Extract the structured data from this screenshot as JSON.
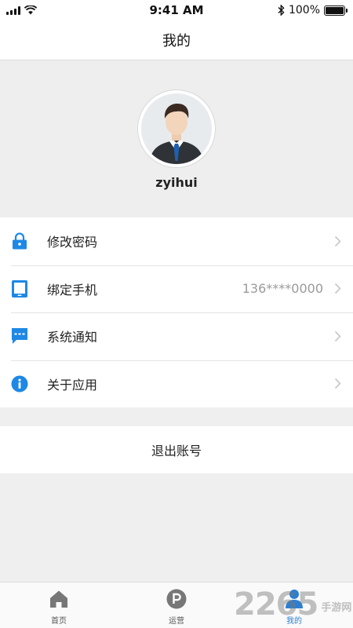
{
  "status_bar": {
    "time": "9:41 AM",
    "battery": "100%",
    "icons": [
      "signal-icon",
      "wifi-icon",
      "bluetooth-icon",
      "battery-icon"
    ]
  },
  "nav": {
    "title": "我的"
  },
  "profile": {
    "username": "zyihui",
    "avatar_icon": "user-avatar-icon"
  },
  "menu": {
    "items": [
      {
        "label": "修改密码",
        "value": "",
        "icon": "lock-icon"
      },
      {
        "label": "绑定手机",
        "value": "136****0000",
        "icon": "phone-icon"
      },
      {
        "label": "系统通知",
        "value": "",
        "icon": "message-icon"
      },
      {
        "label": "关于应用",
        "value": "",
        "icon": "info-icon"
      }
    ]
  },
  "logout": {
    "label": "退出账号"
  },
  "tabs": [
    {
      "label": "首页",
      "icon": "home-icon",
      "active": false
    },
    {
      "label": "运营",
      "icon": "parking-icon",
      "active": false
    },
    {
      "label": "我的",
      "icon": "profile-icon",
      "active": true
    }
  ],
  "watermark": {
    "number": "2265",
    "text": "手游网"
  },
  "colors": {
    "accent": "#2b7fd3",
    "icon_blue": "#1e88e5",
    "background": "#efefef",
    "chevron": "#c7c7cc"
  }
}
